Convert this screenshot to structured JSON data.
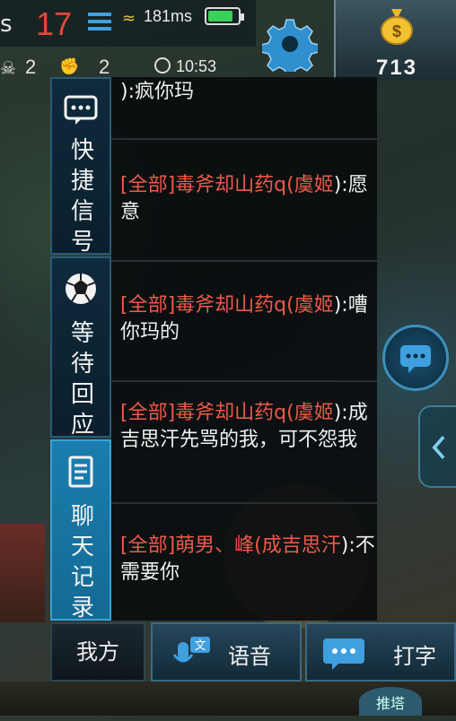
{
  "hud": {
    "left_letter": "s",
    "kills": "17",
    "ping": "181ms",
    "battery_level": 0.85,
    "deaths": "2",
    "assists": "2",
    "time": "10:53",
    "gold": "713",
    "colors": {
      "kills": "#e04a3a",
      "battery": "#3ad05a",
      "accent": "#3fa0e0"
    },
    "icons": [
      "list-icon",
      "wifi-icon",
      "battery-icon",
      "skull-icon",
      "fist-icon",
      "clock-icon",
      "gear-icon",
      "money-bag-icon"
    ]
  },
  "tabs": [
    {
      "icon": "chat-bubble-icon",
      "chars": [
        "快",
        "捷",
        "信",
        "号"
      ],
      "active": false
    },
    {
      "icon": "soccer-ball-icon",
      "chars": [
        "等",
        "待",
        "回",
        "应"
      ],
      "active": false
    },
    {
      "icon": "document-icon",
      "chars": [
        "聊",
        "天",
        "记",
        "录"
      ],
      "active": true
    }
  ],
  "chat": {
    "messages": [
      {
        "prefix": "",
        "text": "):疯你玛"
      },
      {
        "prefix": "[全部]毒斧却山药q(虞姬",
        "text": "):愿意"
      },
      {
        "prefix": "[全部]毒斧却山药q(虞姬",
        "text": "):嘈你玛的"
      },
      {
        "prefix": "[全部]毒斧却山药q(虞姬",
        "text": "):成吉思汗先骂的我，可不怨我"
      },
      {
        "prefix": "[全部]萌男、峰(成吉思汗",
        "text": "):不需要你"
      }
    ],
    "colors": {
      "prefix": "#ec5a4a",
      "text": "#f0f0f0"
    }
  },
  "bottom": {
    "team_label": "我方",
    "voice_label": "语音",
    "type_label": "打字",
    "push_label": "推塔"
  }
}
